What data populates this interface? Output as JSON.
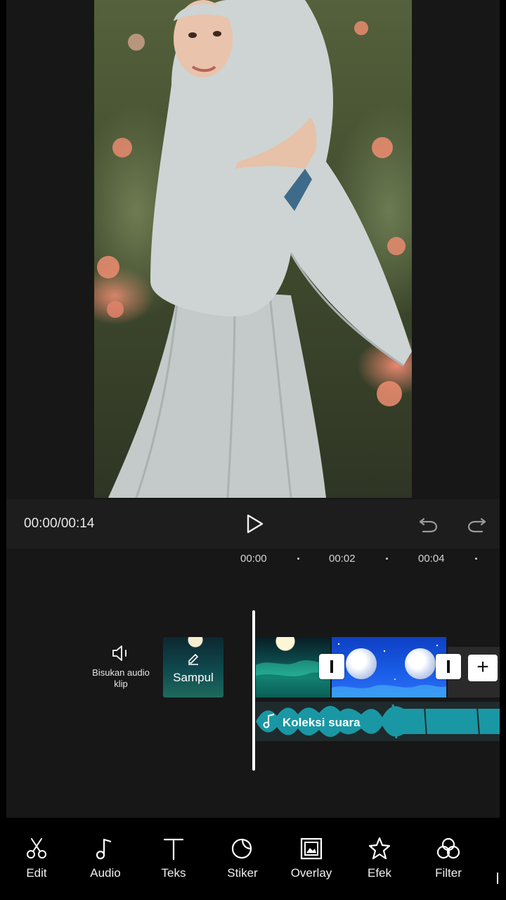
{
  "player": {
    "time": "00:00/00:14"
  },
  "ruler": {
    "ticks": [
      "00:00",
      "00:02",
      "00:04"
    ]
  },
  "timeline": {
    "mute_label": "Bisukan audio klip",
    "cover_label": "Sampul",
    "audio_track_label": "Koleksi suara"
  },
  "toolbar": {
    "items": [
      {
        "label": "Edit",
        "icon": "scissors-icon"
      },
      {
        "label": "Audio",
        "icon": "music-note-icon"
      },
      {
        "label": "Teks",
        "icon": "text-icon"
      },
      {
        "label": "Stiker",
        "icon": "sticker-icon"
      },
      {
        "label": "Overlay",
        "icon": "overlay-icon"
      },
      {
        "label": "Efek",
        "icon": "effects-star-icon"
      },
      {
        "label": "Filter",
        "icon": "filter-icon"
      }
    ]
  },
  "colors": {
    "background": "#171717",
    "controls_bar": "#1d1d1d",
    "waveform": "#1a97a4",
    "toolbar": "#000000"
  }
}
